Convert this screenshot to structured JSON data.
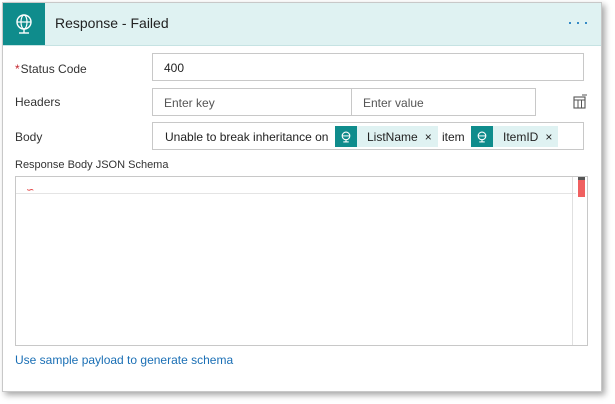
{
  "header": {
    "title": "Response - Failed",
    "icon": "globe-icon",
    "more_label": "···"
  },
  "status_code": {
    "label": "Status Code",
    "required_marker": "*",
    "value": "400"
  },
  "headers": {
    "label": "Headers",
    "key_placeholder": "Enter key",
    "value_placeholder": "Enter value",
    "action_icon": "switch-to-text-mode-icon"
  },
  "body": {
    "label": "Body",
    "text_before": "Unable to break inheritance on",
    "token1": {
      "name": "ListName",
      "remove": "×"
    },
    "text_middle": "item",
    "token2": {
      "name": "ItemID",
      "remove": "×"
    }
  },
  "schema": {
    "label": "Response Body JSON Schema"
  },
  "sample_link": "Use sample payload to generate schema",
  "colors": {
    "teal": "#0f8c8c",
    "header_bg": "#dff2f2",
    "link": "#1a6fb5",
    "required": "#c4262e"
  }
}
